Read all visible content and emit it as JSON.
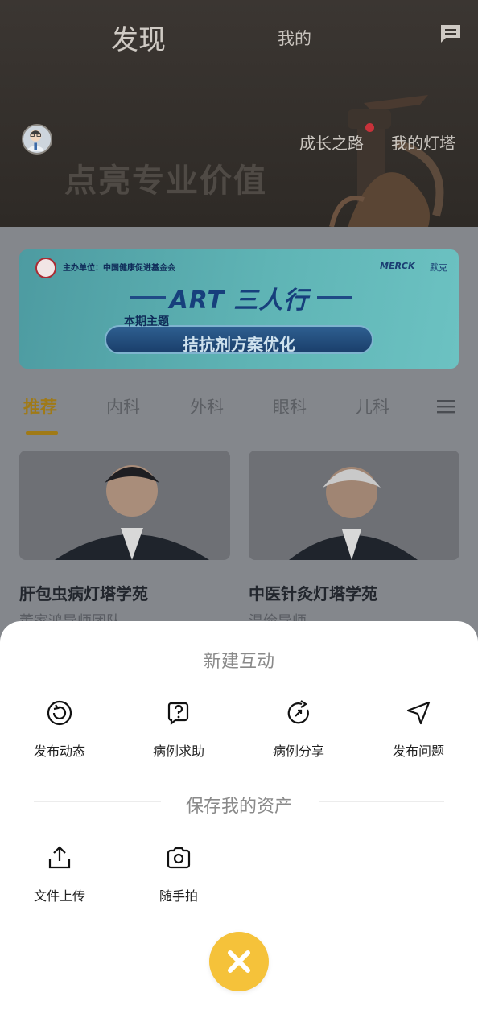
{
  "header": {
    "tab_discover": "发现",
    "tab_mine": "我的",
    "growth_path": "成长之路",
    "my_lighthouse": "我的灯塔",
    "slogan": "点亮专业价值"
  },
  "banner": {
    "organizer": "主办单位：中国健康促进基金会",
    "merck": "MERCK",
    "merck_cn": "默克",
    "title": "ART 三人行",
    "subtitle": "本期主题",
    "topic": "拮抗剂方案优化"
  },
  "categories": [
    "推荐",
    "内科",
    "外科",
    "眼科",
    "儿科"
  ],
  "cards": [
    {
      "title": "肝包虫病灯塔学苑",
      "subtitle": "董家鸿导师团队"
    },
    {
      "title": "中医针灸灯塔学苑",
      "subtitle": "温俭导师"
    }
  ],
  "sheet": {
    "title": "新建互动",
    "actions": [
      {
        "label": "发布动态",
        "icon": "refresh-circle-icon"
      },
      {
        "label": "病例求助",
        "icon": "question-chat-icon"
      },
      {
        "label": "病例分享",
        "icon": "share-rotate-icon"
      },
      {
        "label": "发布问题",
        "icon": "navigation-arrow-icon"
      }
    ],
    "assets_title": "保存我的资产",
    "assets": [
      {
        "label": "文件上传",
        "icon": "upload-icon"
      },
      {
        "label": "随手拍",
        "icon": "camera-icon"
      }
    ]
  },
  "colors": {
    "accent_yellow": "#f5c23a",
    "active_tab": "#a07a16"
  }
}
